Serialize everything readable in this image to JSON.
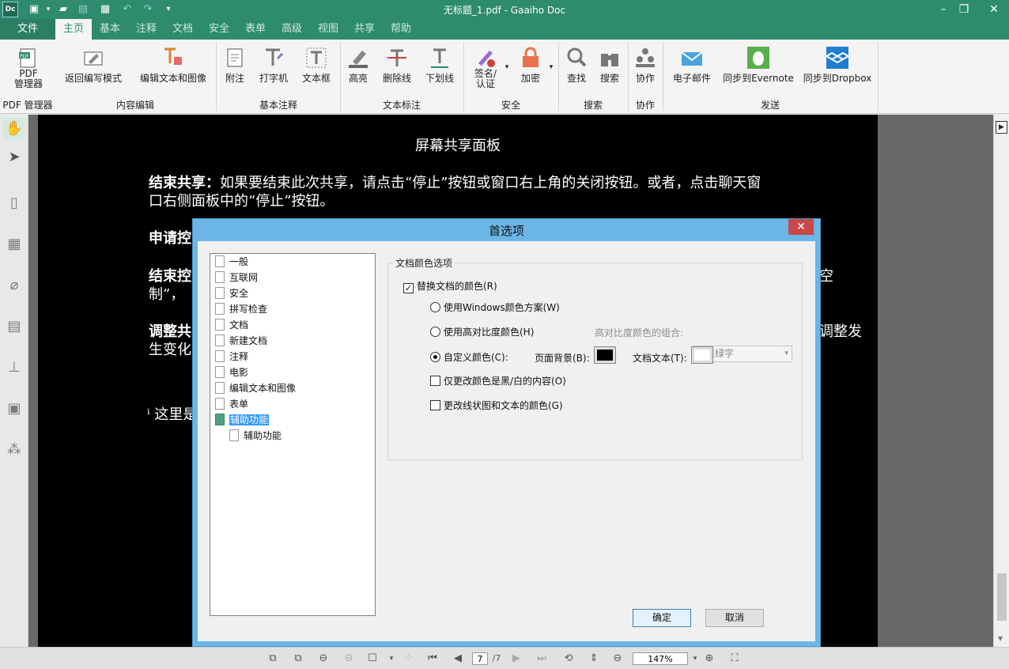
{
  "window": {
    "title": "无标题_1.pdf - Gaaiho Doc",
    "logo": "Dc"
  },
  "menu": {
    "file": "文件",
    "tabs": [
      "主页",
      "基本",
      "注释",
      "文档",
      "安全",
      "表单",
      "高级",
      "视图",
      "共享",
      "帮助"
    ]
  },
  "ribbon": {
    "buttons": {
      "pdf_manager": "PDF\n管理器",
      "back_edit": "返回编写模式",
      "edit_text_image": "编辑文本和图像",
      "note": "附注",
      "typewriter": "打字机",
      "textbox": "文本框",
      "highlight": "高亮",
      "strikeout": "删除线",
      "underline": "下划线",
      "sign": "签名/\n认证",
      "encrypt": "加密",
      "find": "查找",
      "search": "搜索",
      "collab": "协作",
      "email": "电子邮件",
      "evernote": "同步到Evernote",
      "dropbox": "同步到Dropbox"
    },
    "groups": {
      "pdf_manager": "PDF 管理器",
      "content_edit": "内容编辑",
      "basic_comment": "基本注释",
      "text_markup": "文本标注",
      "security": "安全",
      "search": "搜索",
      "collab": "协作",
      "send": "发送"
    }
  },
  "document": {
    "heading": "屏幕共享面板",
    "p1_bold": "结束共享：",
    "p1_line1": "如果要结束此次共享，请点击“停止”按钮或窗口右上角的关闭按钮。或者，点击聊天窗",
    "p1_line2": "口右侧面板中的“停止”按钮。",
    "p2_bold": "申请控",
    "p3_bold": "结束控",
    "p3_right": "空",
    "p3_line2": "制”，",
    "p4_bold": "调整共",
    "p4_right": "调整发",
    "p4_line2": "生变化",
    "p5": "ⁱ 这里是"
  },
  "dialog": {
    "title": "首选项",
    "tree": [
      "一般",
      "互联网",
      "安全",
      "拼写检查",
      "文档",
      "新建文档",
      "注释",
      "电影",
      "编辑文本和图像",
      "表单",
      "辅助功能"
    ],
    "tree_child": "辅助功能",
    "group_title": "文档颜色选项",
    "replace_colors": "替换文档的颜色(R)",
    "windows_scheme": "使用Windows颜色方案(W)",
    "high_contrast": "使用高对比度颜色(H)",
    "combo_label": "高对比度颜色的组合:",
    "combo_value": "黑底绿字",
    "custom_color": "自定义颜色(C):",
    "page_bg": "页面背景(B):",
    "doc_text": "文档文本(T):",
    "page_bg_color": "#000000",
    "doc_text_color": "#ffffff",
    "only_bw": "仅更改颜色是黑/白的内容(O)",
    "line_art": "更改线状图和文本的颜色(G)",
    "ok": "确定",
    "cancel": "取消"
  },
  "status": {
    "page_current": "7",
    "page_total": "/7",
    "zoom": "147%"
  },
  "colors": {
    "brand": "#2e8b6e",
    "dialog_frame": "#6bb6e6",
    "close_red": "#c74848"
  }
}
